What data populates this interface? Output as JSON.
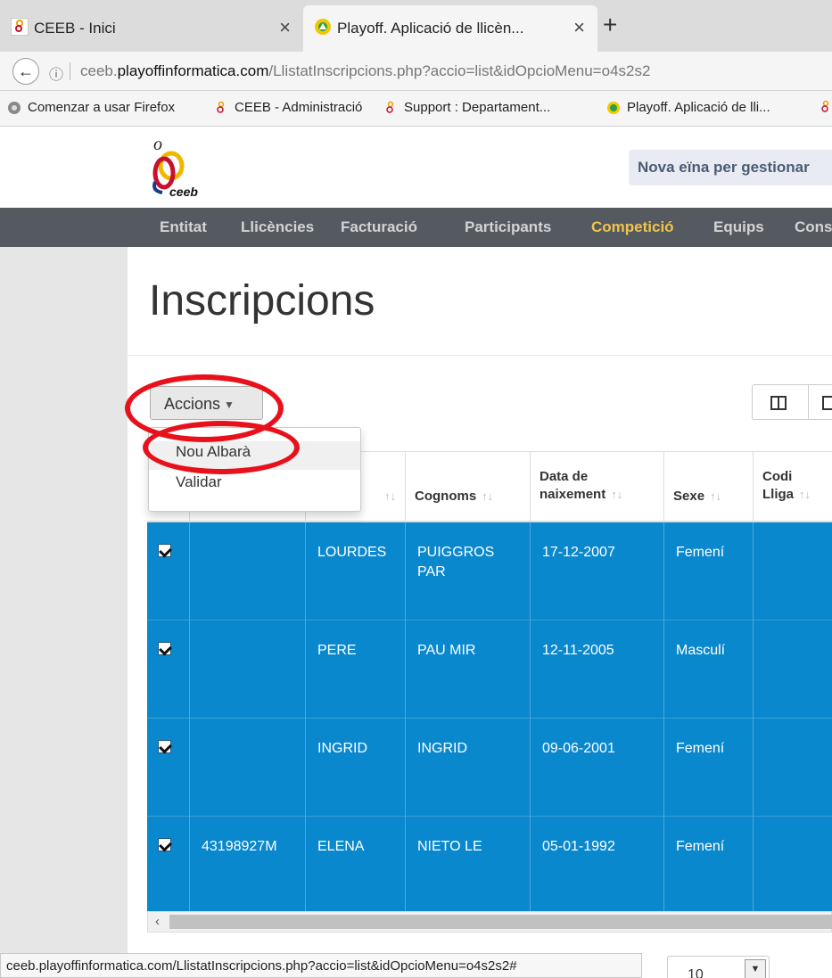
{
  "browser": {
    "tabs": [
      {
        "title": "CEEB - Inici"
      },
      {
        "title": "Playoff. Aplicació de llicèn..."
      }
    ],
    "url_prefix": "ceeb.",
    "url_domain": "playoffinformatica.com",
    "url_path": "/LlistatInscripcions.php?accio=list&idOpcioMenu=o4s2s2",
    "bookmarks": [
      "Comenzar a usar Firefox",
      "CEEB - Administració",
      "Support : Departament...",
      "Playoff. Aplicació de lli..."
    ],
    "status_url": "ceeb.playoffinformatica.com/LlistatInscripcions.php?accio=list&idOpcioMenu=o4s2s2#"
  },
  "site": {
    "logo_text": "ceeb",
    "banner": "Nova eïna per gestionar",
    "nav": [
      "Entitat",
      "Llicències",
      "Facturació",
      "Participants",
      "Competició",
      "Equips",
      "Cons"
    ],
    "active_nav": "Competició"
  },
  "page": {
    "title": "Inscripcions",
    "actions_label": "Accions",
    "actions_menu": [
      "Nou Albarà",
      "Validar"
    ],
    "page_size": "10"
  },
  "table": {
    "headers": [
      "",
      "",
      "",
      "Cognoms",
      "Data de naixement",
      "Sexe",
      "Codi Lliga"
    ],
    "rows": [
      {
        "dni": "",
        "nom": "LOURDES",
        "cognoms": "PUIGGROS PAR",
        "data": "17-12-2007",
        "sexe": "Femení",
        "codi": ""
      },
      {
        "dni": "",
        "nom": "PERE",
        "cognoms": "PAU MIR",
        "data": "12-11-2005",
        "sexe": "Masculí",
        "codi": ""
      },
      {
        "dni": "",
        "nom": "INGRID",
        "cognoms": "INGRID",
        "data": "09-06-2001",
        "sexe": "Femení",
        "codi": ""
      },
      {
        "dni": "43198927M",
        "nom": "ELENA",
        "cognoms": "NIETO LE",
        "data": "05-01-1992",
        "sexe": "Femení",
        "codi": ""
      }
    ]
  },
  "colors": {
    "navbar": "#555a61",
    "active_nav": "#f0c44a",
    "row_selected": "#0a88cd",
    "annotation": "#e8101a"
  }
}
